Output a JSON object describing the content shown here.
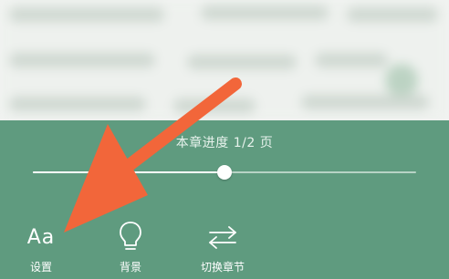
{
  "panel": {
    "progress_label": "本章进度 1/2 页",
    "progress_fraction": 0.5
  },
  "toolbar": {
    "items": [
      {
        "label": "设置",
        "icon": "font-size-icon",
        "glyph": "Aa"
      },
      {
        "label": "背景",
        "icon": "lightbulb-icon"
      },
      {
        "label": "切换章节",
        "icon": "swap-arrows-icon"
      }
    ]
  },
  "colors": {
    "panel_bg": "#5f9b7f",
    "annotation_arrow": "#f2663a",
    "slider_fill": "#ffffff"
  }
}
